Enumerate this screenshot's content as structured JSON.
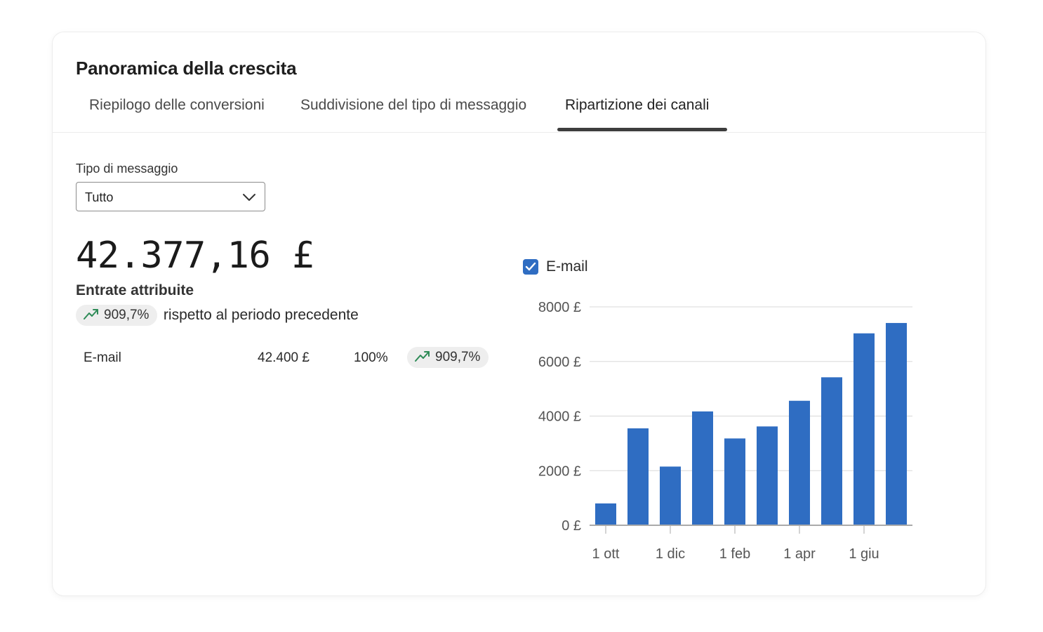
{
  "card": {
    "title": "Panoramica della crescita",
    "tabs": [
      {
        "label": "Riepilogo delle conversioni",
        "active": false
      },
      {
        "label": "Suddivisione del tipo di messaggio",
        "active": false
      },
      {
        "label": "Ripartizione dei canali",
        "active": true
      }
    ]
  },
  "filter": {
    "label": "Tipo di messaggio",
    "selected": "Tutto"
  },
  "summary": {
    "value": "42.377,16 £",
    "label": "Entrate attribuite",
    "change": "909,7%",
    "change_text": "rispetto al periodo precedente"
  },
  "channels": [
    {
      "name": "E-mail",
      "amount": "42.400 £",
      "share": "100%",
      "change": "909,7%"
    }
  ],
  "colors": {
    "accent": "#2f6dc2",
    "trend_up": "#2e8b57",
    "pill_bg": "#eeeeee"
  },
  "icons": {
    "trend": "trending-up-icon",
    "dropdown": "chevron-down-icon",
    "legend": "checkbox-checked-icon"
  },
  "chart_data": {
    "type": "bar",
    "legend": [
      {
        "name": "E-mail",
        "checked": true
      }
    ],
    "series": [
      {
        "name": "E-mail",
        "values": [
          800,
          3550,
          2150,
          4170,
          3180,
          3620,
          4560,
          5420,
          7030,
          7410
        ]
      }
    ],
    "x_ticks": [
      "1 ott",
      "1 dic",
      "1 feb",
      "1 apr",
      "1 giu"
    ],
    "y_ticks": [
      "0 £",
      "2000 £",
      "4000 £",
      "6000 £",
      "8000 £"
    ],
    "ylim": [
      0,
      8000
    ],
    "grid": true
  }
}
